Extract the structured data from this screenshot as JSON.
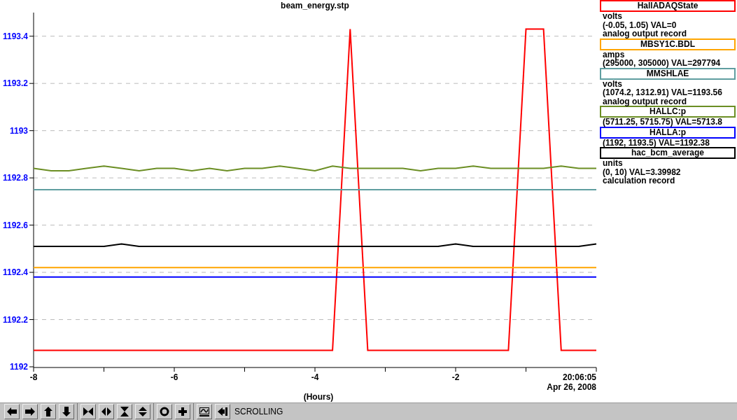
{
  "chart": {
    "chart_data": {
      "type": "line",
      "title": "beam_energy.stp",
      "xlabel": "(Hours)",
      "x": [
        -8,
        -7.75,
        -7.5,
        -7.25,
        -7,
        -6.75,
        -6.5,
        -6.25,
        -6,
        -5.75,
        -5.5,
        -5.25,
        -5,
        -4.75,
        -4.5,
        -4.25,
        -4,
        -3.75,
        -3.5,
        -3.25,
        -3,
        -2.75,
        -2.5,
        -2.25,
        -2,
        -1.75,
        -1.5,
        -1.25,
        -1,
        -0.75,
        -0.5,
        -0.25,
        0
      ],
      "series": [
        {
          "name": "HallADAQState",
          "color": "#ff0000",
          "values": [
            1192.07,
            1192.07,
            1192.07,
            1192.07,
            1192.07,
            1192.07,
            1192.07,
            1192.07,
            1192.07,
            1192.07,
            1192.07,
            1192.07,
            1192.07,
            1192.07,
            1192.07,
            1192.07,
            1192.07,
            1192.07,
            1193.43,
            1192.07,
            1192.07,
            1192.07,
            1192.07,
            1192.07,
            1192.07,
            1192.07,
            1192.07,
            1192.07,
            1193.43,
            1193.43,
            1192.07,
            1192.07,
            1192.07
          ]
        },
        {
          "name": "MBSY1C.BDL",
          "color": "#ffa500",
          "values": [
            1192.42,
            1192.42,
            1192.42,
            1192.42,
            1192.42,
            1192.42,
            1192.42,
            1192.42,
            1192.42,
            1192.42,
            1192.42,
            1192.42,
            1192.42,
            1192.42,
            1192.42,
            1192.42,
            1192.42,
            1192.42,
            1192.42,
            1192.42,
            1192.42,
            1192.42,
            1192.42,
            1192.42,
            1192.42,
            1192.42,
            1192.42,
            1192.42,
            1192.42,
            1192.42,
            1192.42,
            1192.42,
            1192.42
          ]
        },
        {
          "name": "MMSHLAE",
          "color": "#5f9ea0",
          "values": [
            1192.75,
            1192.75,
            1192.75,
            1192.75,
            1192.75,
            1192.75,
            1192.75,
            1192.75,
            1192.75,
            1192.75,
            1192.75,
            1192.75,
            1192.75,
            1192.75,
            1192.75,
            1192.75,
            1192.75,
            1192.75,
            1192.75,
            1192.75,
            1192.75,
            1192.75,
            1192.75,
            1192.75,
            1192.75,
            1192.75,
            1192.75,
            1192.75,
            1192.75,
            1192.75,
            1192.75,
            1192.75,
            1192.75
          ]
        },
        {
          "name": "HALLC:p",
          "color": "#6b8e23",
          "values": [
            1192.84,
            1192.83,
            1192.83,
            1192.84,
            1192.85,
            1192.84,
            1192.83,
            1192.84,
            1192.84,
            1192.83,
            1192.84,
            1192.83,
            1192.84,
            1192.84,
            1192.85,
            1192.84,
            1192.83,
            1192.85,
            1192.84,
            1192.84,
            1192.84,
            1192.84,
            1192.83,
            1192.84,
            1192.84,
            1192.85,
            1192.84,
            1192.84,
            1192.84,
            1192.84,
            1192.85,
            1192.84,
            1192.84
          ]
        },
        {
          "name": "HALLA:p",
          "color": "#0000ff",
          "values": [
            1192.38,
            1192.38,
            1192.38,
            1192.38,
            1192.38,
            1192.38,
            1192.38,
            1192.38,
            1192.38,
            1192.38,
            1192.38,
            1192.38,
            1192.38,
            1192.38,
            1192.38,
            1192.38,
            1192.38,
            1192.38,
            1192.38,
            1192.38,
            1192.38,
            1192.38,
            1192.38,
            1192.38,
            1192.38,
            1192.38,
            1192.38,
            1192.38,
            1192.38,
            1192.38,
            1192.38,
            1192.38,
            1192.38
          ]
        },
        {
          "name": "hac_bcm_average",
          "color": "#000000",
          "values": [
            1192.51,
            1192.51,
            1192.51,
            1192.51,
            1192.51,
            1192.52,
            1192.51,
            1192.51,
            1192.51,
            1192.51,
            1192.51,
            1192.51,
            1192.51,
            1192.51,
            1192.51,
            1192.51,
            1192.51,
            1192.51,
            1192.51,
            1192.51,
            1192.51,
            1192.51,
            1192.51,
            1192.51,
            1192.52,
            1192.51,
            1192.51,
            1192.51,
            1192.51,
            1192.51,
            1192.51,
            1192.51,
            1192.52
          ]
        }
      ],
      "xlim": [
        -8,
        0
      ],
      "ylim": [
        1192,
        1193.5
      ],
      "grid": true,
      "xticks": [
        {
          "value": -8,
          "label": "-8"
        },
        {
          "value": -6,
          "label": "-6"
        },
        {
          "value": -4,
          "label": "-4"
        },
        {
          "value": -2,
          "label": "-2"
        }
      ],
      "yticks": [
        {
          "value": 1192,
          "label": "1192"
        },
        {
          "value": 1192.2,
          "label": "1192.2"
        },
        {
          "value": 1192.4,
          "label": "1192.4"
        },
        {
          "value": 1192.6,
          "label": "1192.6"
        },
        {
          "value": 1192.8,
          "label": "1192.8"
        },
        {
          "value": 1193,
          "label": "1193"
        },
        {
          "value": 1193.2,
          "label": "1193.2"
        },
        {
          "value": 1193.4,
          "label": "1193.4"
        }
      ]
    },
    "end_time": "20:06:05",
    "end_date": "Apr 26, 2008"
  },
  "legend": [
    {
      "units": "volts",
      "range": "(-0.05, 1.05) VAL=0",
      "record": "analog output record"
    },
    {
      "units": "amps",
      "range": "(295000, 305000) VAL=297794"
    },
    {
      "units": "volts",
      "range": "(1074.2, 1312.91) VAL=1193.56",
      "record": "analog output record"
    },
    {
      "range": "(5711.25, 5715.75) VAL=5713.8"
    },
    {
      "range": "(1192, 1193.5) VAL=1192.38"
    },
    {
      "units": "units",
      "range": "(0, 10) VAL=3.39982",
      "record": "calculation record"
    }
  ],
  "toolbar": {
    "mode": "SCROLLING"
  }
}
